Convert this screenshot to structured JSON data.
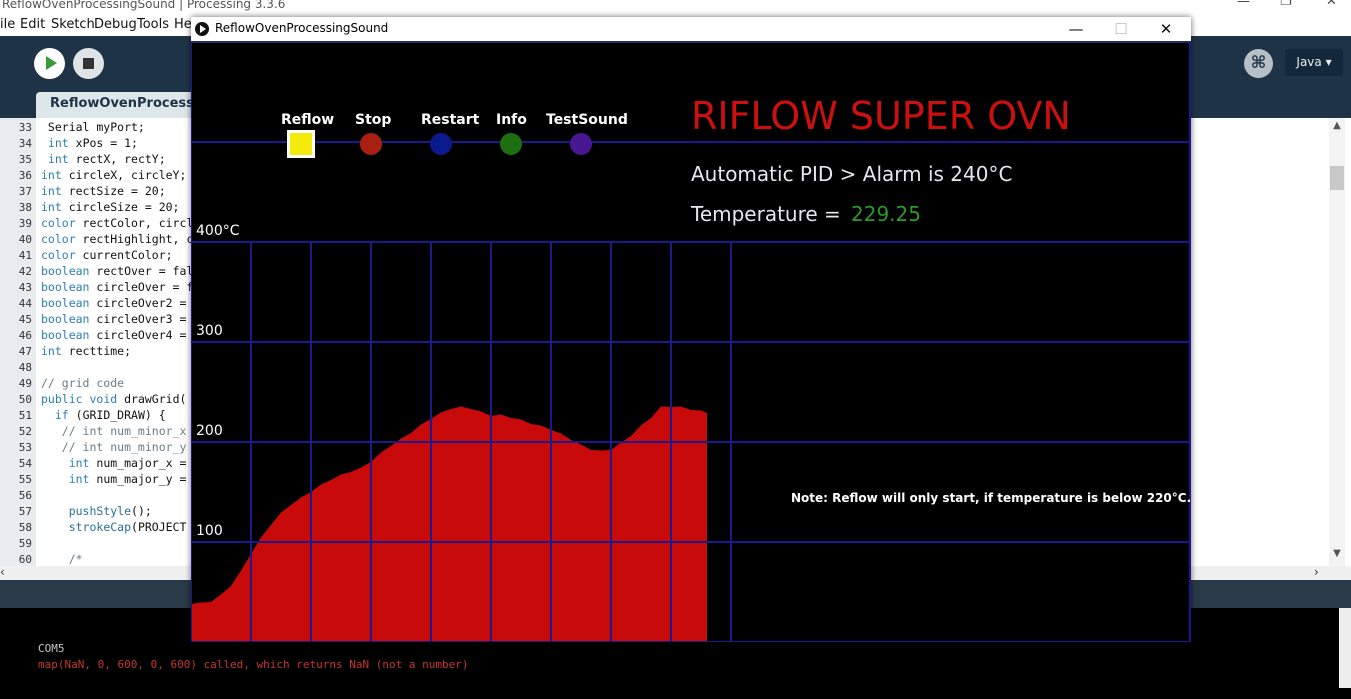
{
  "ide": {
    "title": "ReflowOvenProcessingSound | Processing 3.3.6",
    "menu": [
      "ile",
      "Edit",
      "Sketch",
      "Debug",
      "Tools",
      "He"
    ],
    "mode": "Java ▾",
    "tab_name": "ReflowOvenProcessingS",
    "code_lines": [
      {
        "n": "33",
        "t": " Serial myPort;"
      },
      {
        "n": "34",
        "t": " int xPos = 1;"
      },
      {
        "n": "35",
        "t": " int rectX, rectY;"
      },
      {
        "n": "36",
        "t": "int circleX, circleY;"
      },
      {
        "n": "37",
        "t": "int rectSize = 20;"
      },
      {
        "n": "38",
        "t": "int circleSize = 20;"
      },
      {
        "n": "39",
        "t": "color rectColor, circl"
      },
      {
        "n": "40",
        "t": "color rectHighlight, c"
      },
      {
        "n": "41",
        "t": "color currentColor;"
      },
      {
        "n": "42",
        "t": "boolean rectOver = fal"
      },
      {
        "n": "43",
        "t": "boolean circleOver = f"
      },
      {
        "n": "44",
        "t": "boolean circleOver2 ="
      },
      {
        "n": "45",
        "t": "boolean circleOver3 ="
      },
      {
        "n": "46",
        "t": "boolean circleOver4 ="
      },
      {
        "n": "47",
        "t": "int recttime;"
      },
      {
        "n": "48",
        "t": ""
      },
      {
        "n": "49",
        "t": "// grid code"
      },
      {
        "n": "50",
        "t": "public void drawGrid("
      },
      {
        "n": "51",
        "t": "  if (GRID_DRAW) {"
      },
      {
        "n": "52",
        "t": "   // int num_minor_x"
      },
      {
        "n": "53",
        "t": "   // int num_minor_y"
      },
      {
        "n": "54",
        "t": "    int num_major_x ="
      },
      {
        "n": "55",
        "t": "    int num_major_y ="
      },
      {
        "n": "56",
        "t": ""
      },
      {
        "n": "57",
        "t": "    pushStyle();"
      },
      {
        "n": "58",
        "t": "    strokeCap(PROJECT"
      },
      {
        "n": "59",
        "t": ""
      },
      {
        "n": "60",
        "t": "    /*"
      }
    ],
    "console": {
      "port": "COM5",
      "error": "map(NaN, 0, 600, 0, 600) called, which returns NaN (not a number)"
    }
  },
  "sketch": {
    "window_title": "ReflowOvenProcessingSound",
    "buttons": [
      {
        "label": "Reflow",
        "color": "#f5eb0a",
        "shape": "square"
      },
      {
        "label": "Stop",
        "color": "#a82010",
        "shape": "circle"
      },
      {
        "label": "Restart",
        "color": "#0a1a8c",
        "shape": "circle"
      },
      {
        "label": "Info",
        "color": "#1e6e12",
        "shape": "circle"
      },
      {
        "label": "TestSound",
        "color": "#4a1590",
        "shape": "circle"
      }
    ],
    "heading": "RIFLOW SUPER OVN",
    "alarm_text": "Automatic PID > Alarm is 240°C",
    "temperature_label": "Temperature =",
    "temperature_value": "229.25",
    "note": "Note: Reflow will only start, if temperature is below 220°C.",
    "y_ticks": [
      "400°C",
      "300",
      "200",
      "100"
    ],
    "colors": {
      "fill": "#c80a0a",
      "grid": "#1a1a8c",
      "heading": "#cc1010",
      "value": "#2a9a2a"
    }
  },
  "chart_data": {
    "type": "area",
    "title": "",
    "xlabel": "",
    "ylabel": "",
    "ylim": [
      0,
      400
    ],
    "y_tick_labels": [
      "400°C",
      "300",
      "200",
      "100"
    ],
    "series": [
      {
        "color": "#c80a0a",
        "points": [
          [
            0,
            38
          ],
          [
            10,
            38
          ],
          [
            20,
            40
          ],
          [
            30,
            46
          ],
          [
            40,
            56
          ],
          [
            50,
            70
          ],
          [
            60,
            88
          ],
          [
            70,
            103
          ],
          [
            80,
            117
          ],
          [
            90,
            128
          ],
          [
            100,
            137
          ],
          [
            110,
            143
          ],
          [
            120,
            150
          ],
          [
            130,
            156
          ],
          [
            140,
            162
          ],
          [
            150,
            166
          ],
          [
            160,
            170
          ],
          [
            170,
            173
          ],
          [
            180,
            180
          ],
          [
            190,
            188
          ],
          [
            200,
            196
          ],
          [
            210,
            202
          ],
          [
            220,
            209
          ],
          [
            230,
            216
          ],
          [
            240,
            223
          ],
          [
            250,
            228
          ],
          [
            260,
            233
          ],
          [
            270,
            234
          ],
          [
            280,
            233
          ],
          [
            290,
            229
          ],
          [
            300,
            226
          ],
          [
            310,
            226
          ],
          [
            320,
            224
          ],
          [
            330,
            221
          ],
          [
            340,
            218
          ],
          [
            350,
            215
          ],
          [
            360,
            212
          ],
          [
            370,
            207
          ],
          [
            380,
            202
          ],
          [
            390,
            196
          ],
          [
            400,
            192
          ],
          [
            410,
            190
          ],
          [
            420,
            192
          ],
          [
            430,
            198
          ],
          [
            440,
            206
          ],
          [
            450,
            215
          ],
          [
            460,
            224
          ],
          [
            470,
            234
          ],
          [
            480,
            235
          ],
          [
            490,
            234
          ],
          [
            500,
            232
          ],
          [
            510,
            230
          ],
          [
            516,
            229
          ]
        ]
      }
    ]
  }
}
